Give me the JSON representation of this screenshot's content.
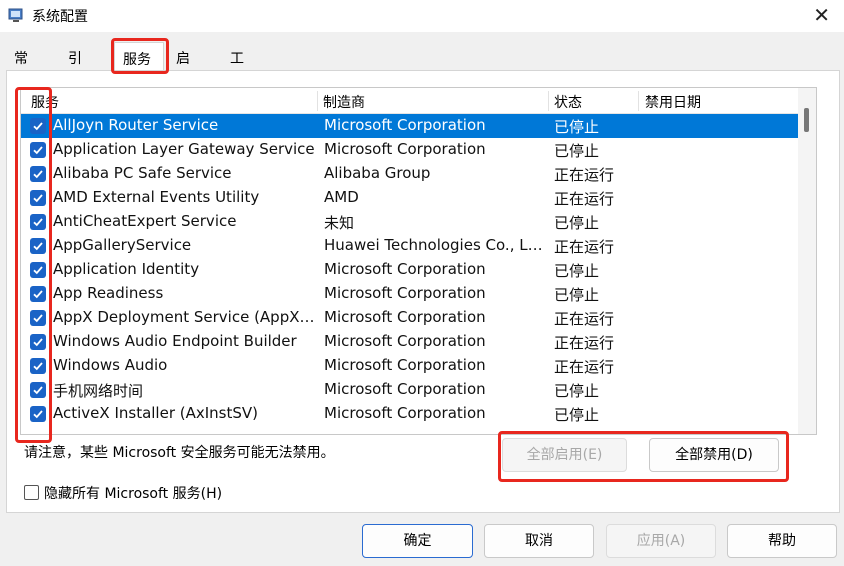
{
  "window": {
    "title": "系统配置"
  },
  "tabs": [
    {
      "label": "常规"
    },
    {
      "label": "引导"
    },
    {
      "label": "服务",
      "active": true
    },
    {
      "label": "启动"
    },
    {
      "label": "工具"
    }
  ],
  "services_table": {
    "columns": [
      "服务",
      "制造商",
      "状态",
      "禁用日期"
    ],
    "rows": [
      {
        "name": "AllJoyn Router Service",
        "manufacturer": "Microsoft Corporation",
        "status": "已停止",
        "disabled_date": "",
        "checked": true,
        "selected": true
      },
      {
        "name": "Application Layer Gateway Service",
        "manufacturer": "Microsoft Corporation",
        "status": "已停止",
        "disabled_date": "",
        "checked": true
      },
      {
        "name": "Alibaba PC Safe Service",
        "manufacturer": "Alibaba Group",
        "status": "正在运行",
        "disabled_date": "",
        "checked": true
      },
      {
        "name": "AMD External Events Utility",
        "manufacturer": "AMD",
        "status": "正在运行",
        "disabled_date": "",
        "checked": true
      },
      {
        "name": "AntiCheatExpert Service",
        "manufacturer": "未知",
        "status": "已停止",
        "disabled_date": "",
        "checked": true
      },
      {
        "name": "AppGalleryService",
        "manufacturer": "Huawei Technologies Co., Lt...",
        "status": "正在运行",
        "disabled_date": "",
        "checked": true
      },
      {
        "name": "Application Identity",
        "manufacturer": "Microsoft Corporation",
        "status": "已停止",
        "disabled_date": "",
        "checked": true
      },
      {
        "name": "App Readiness",
        "manufacturer": "Microsoft Corporation",
        "status": "已停止",
        "disabled_date": "",
        "checked": true
      },
      {
        "name": "AppX Deployment Service (AppXS...",
        "manufacturer": "Microsoft Corporation",
        "status": "正在运行",
        "disabled_date": "",
        "checked": true
      },
      {
        "name": "Windows Audio Endpoint Builder",
        "manufacturer": "Microsoft Corporation",
        "status": "正在运行",
        "disabled_date": "",
        "checked": true
      },
      {
        "name": "Windows Audio",
        "manufacturer": "Microsoft Corporation",
        "status": "正在运行",
        "disabled_date": "",
        "checked": true
      },
      {
        "name": "手机网络时间",
        "manufacturer": "Microsoft Corporation",
        "status": "已停止",
        "disabled_date": "",
        "checked": true
      },
      {
        "name": "ActiveX Installer (AxInstSV)",
        "manufacturer": "Microsoft Corporation",
        "status": "已停止",
        "disabled_date": "",
        "checked": true
      }
    ]
  },
  "note": "请注意，某些 Microsoft 安全服务可能无法禁用。",
  "buttons": {
    "enable_all": "全部启用(E)",
    "disable_all": "全部禁用(D)",
    "ok": "确定",
    "cancel": "取消",
    "apply": "应用(A)",
    "help": "帮助"
  },
  "hide_ms_label": "隐藏所有 Microsoft 服务(H)",
  "colors": {
    "selection": "#0078d7",
    "checkbox": "#1a63c6",
    "highlight_annotation": "#e8271e"
  }
}
